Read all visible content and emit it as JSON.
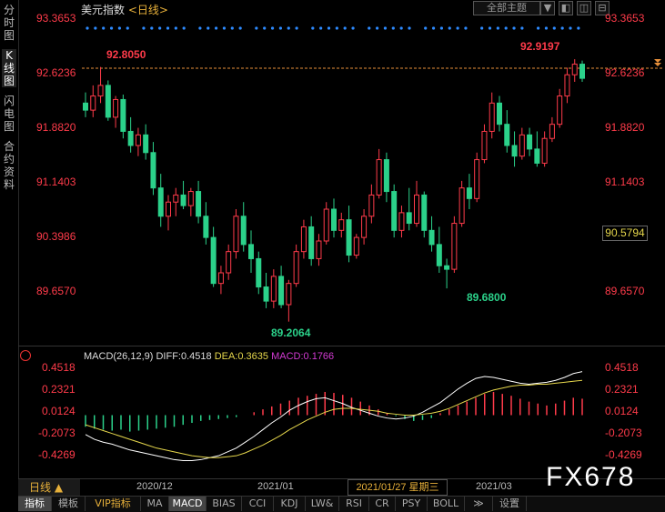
{
  "left_tabs": [
    "分时图",
    "K线图",
    "闪电图",
    "合约资料"
  ],
  "header": {
    "title": "美元指数",
    "period": "<日线>"
  },
  "top_controls": {
    "theme_select": "全部主题",
    "btn1": "▼",
    "btn2": "◧",
    "btn3": "◫",
    "btn4": "⊟"
  },
  "price_axis": {
    "left_labels": [
      "93.3653",
      "92.6236",
      "91.8820",
      "91.1403",
      "90.3986",
      "89.6570"
    ],
    "right_labels": [
      "93.3653",
      "92.6236",
      "91.8820",
      "91.1403",
      "90.3986",
      "89.6570"
    ],
    "current_price": "90.5794",
    "ylim": [
      89.0,
      93.5
    ]
  },
  "annotations": {
    "high_left": "92.8050",
    "high_right": "92.9197",
    "low_1": "89.2064",
    "low_2": "89.6800"
  },
  "macd": {
    "label": "MACD(26,12,9)",
    "diff": "DIFF:0.4518",
    "dea": "DEA:0.3635",
    "macd": "MACD:0.1766",
    "labels": [
      "0.4518",
      "0.2321",
      "0.0124",
      "-0.2073",
      "-0.4269"
    ]
  },
  "bottom": {
    "period_button": "日线 ▲",
    "dates": [
      "2020/12",
      "2021/01",
      "2021/03"
    ],
    "current_date": "2021/01/27 星期三"
  },
  "tabs": [
    "指标",
    "模板",
    "VIP指标",
    "MA",
    "MACD",
    "BIAS",
    "CCI",
    "KDJ",
    "LW&",
    "RSI",
    "CR",
    "PSY",
    "BOLL",
    "≫",
    "设置"
  ],
  "watermark": "FX678",
  "colors": {
    "up": "#ff3b4a",
    "down": "#2bd18a",
    "diff": "#ffffff",
    "dea": "#e6d74c",
    "macd_label": "#d33bd3",
    "period": "#e7b03a"
  },
  "chart_data": {
    "type": "candlestick",
    "candles": [
      {
        "o": 92.3,
        "h": 92.45,
        "l": 92.1,
        "c": 92.2
      },
      {
        "o": 92.2,
        "h": 92.55,
        "l": 92.1,
        "c": 92.4
      },
      {
        "o": 92.4,
        "h": 92.81,
        "l": 92.3,
        "c": 92.55
      },
      {
        "o": 92.55,
        "h": 92.62,
        "l": 92.05,
        "c": 92.1
      },
      {
        "o": 92.1,
        "h": 92.4,
        "l": 91.95,
        "c": 92.35
      },
      {
        "o": 92.35,
        "h": 92.42,
        "l": 91.8,
        "c": 91.9
      },
      {
        "o": 91.9,
        "h": 92.1,
        "l": 91.6,
        "c": 91.7
      },
      {
        "o": 91.7,
        "h": 91.95,
        "l": 91.55,
        "c": 91.85
      },
      {
        "o": 91.85,
        "h": 92.0,
        "l": 91.5,
        "c": 91.6
      },
      {
        "o": 91.6,
        "h": 91.75,
        "l": 91.0,
        "c": 91.1
      },
      {
        "o": 91.1,
        "h": 91.3,
        "l": 90.55,
        "c": 90.7
      },
      {
        "o": 90.7,
        "h": 91.0,
        "l": 90.5,
        "c": 90.9
      },
      {
        "o": 90.9,
        "h": 91.1,
        "l": 90.7,
        "c": 91.0
      },
      {
        "o": 91.0,
        "h": 91.2,
        "l": 90.8,
        "c": 90.85
      },
      {
        "o": 90.85,
        "h": 91.1,
        "l": 90.7,
        "c": 91.05
      },
      {
        "o": 91.05,
        "h": 91.2,
        "l": 90.6,
        "c": 90.7
      },
      {
        "o": 90.7,
        "h": 90.9,
        "l": 90.3,
        "c": 90.4
      },
      {
        "o": 90.4,
        "h": 90.55,
        "l": 89.7,
        "c": 89.75
      },
      {
        "o": 89.75,
        "h": 90.0,
        "l": 89.6,
        "c": 89.9
      },
      {
        "o": 89.9,
        "h": 90.3,
        "l": 89.8,
        "c": 90.2
      },
      {
        "o": 90.2,
        "h": 90.8,
        "l": 90.1,
        "c": 90.7
      },
      {
        "o": 90.7,
        "h": 90.9,
        "l": 90.2,
        "c": 90.3
      },
      {
        "o": 90.3,
        "h": 90.5,
        "l": 89.9,
        "c": 90.1
      },
      {
        "o": 90.1,
        "h": 90.2,
        "l": 89.6,
        "c": 89.7
      },
      {
        "o": 89.7,
        "h": 89.9,
        "l": 89.4,
        "c": 89.5
      },
      {
        "o": 89.5,
        "h": 89.95,
        "l": 89.4,
        "c": 89.85
      },
      {
        "o": 89.85,
        "h": 90.0,
        "l": 89.4,
        "c": 89.45
      },
      {
        "o": 89.45,
        "h": 89.8,
        "l": 89.21,
        "c": 89.75
      },
      {
        "o": 89.75,
        "h": 90.3,
        "l": 89.7,
        "c": 90.2
      },
      {
        "o": 90.2,
        "h": 90.65,
        "l": 90.1,
        "c": 90.55
      },
      {
        "o": 90.55,
        "h": 90.7,
        "l": 90.0,
        "c": 90.1
      },
      {
        "o": 90.1,
        "h": 90.45,
        "l": 90.0,
        "c": 90.35
      },
      {
        "o": 90.35,
        "h": 90.9,
        "l": 90.3,
        "c": 90.8
      },
      {
        "o": 90.8,
        "h": 90.95,
        "l": 90.4,
        "c": 90.5
      },
      {
        "o": 90.5,
        "h": 90.75,
        "l": 90.4,
        "c": 90.65
      },
      {
        "o": 90.65,
        "h": 90.85,
        "l": 90.05,
        "c": 90.15
      },
      {
        "o": 90.15,
        "h": 90.45,
        "l": 90.1,
        "c": 90.4
      },
      {
        "o": 90.4,
        "h": 90.8,
        "l": 90.3,
        "c": 90.7
      },
      {
        "o": 90.7,
        "h": 91.15,
        "l": 90.6,
        "c": 91.0
      },
      {
        "o": 91.0,
        "h": 91.65,
        "l": 90.95,
        "c": 91.5
      },
      {
        "o": 91.5,
        "h": 91.6,
        "l": 90.9,
        "c": 91.05
      },
      {
        "o": 91.05,
        "h": 91.15,
        "l": 90.4,
        "c": 90.5
      },
      {
        "o": 90.5,
        "h": 90.85,
        "l": 90.4,
        "c": 90.75
      },
      {
        "o": 90.75,
        "h": 91.1,
        "l": 90.5,
        "c": 90.6
      },
      {
        "o": 90.6,
        "h": 91.2,
        "l": 90.55,
        "c": 91.0
      },
      {
        "o": 91.0,
        "h": 91.05,
        "l": 90.4,
        "c": 90.5
      },
      {
        "o": 90.5,
        "h": 90.7,
        "l": 90.2,
        "c": 90.3
      },
      {
        "o": 90.3,
        "h": 90.55,
        "l": 89.9,
        "c": 90.0
      },
      {
        "o": 90.0,
        "h": 90.1,
        "l": 89.68,
        "c": 89.95
      },
      {
        "o": 89.95,
        "h": 90.7,
        "l": 89.9,
        "c": 90.6
      },
      {
        "o": 90.6,
        "h": 91.2,
        "l": 90.55,
        "c": 91.1
      },
      {
        "o": 91.1,
        "h": 91.3,
        "l": 90.8,
        "c": 90.95
      },
      {
        "o": 90.95,
        "h": 91.6,
        "l": 90.9,
        "c": 91.5
      },
      {
        "o": 91.5,
        "h": 92.0,
        "l": 91.45,
        "c": 91.9
      },
      {
        "o": 91.9,
        "h": 92.45,
        "l": 91.8,
        "c": 92.3
      },
      {
        "o": 92.3,
        "h": 92.4,
        "l": 91.9,
        "c": 92.0
      },
      {
        "o": 92.0,
        "h": 92.2,
        "l": 91.6,
        "c": 91.7
      },
      {
        "o": 91.7,
        "h": 91.9,
        "l": 91.4,
        "c": 91.55
      },
      {
        "o": 91.55,
        "h": 91.95,
        "l": 91.5,
        "c": 91.85
      },
      {
        "o": 91.85,
        "h": 91.95,
        "l": 91.55,
        "c": 91.65
      },
      {
        "o": 91.65,
        "h": 91.9,
        "l": 91.4,
        "c": 91.45
      },
      {
        "o": 91.45,
        "h": 91.9,
        "l": 91.4,
        "c": 91.8
      },
      {
        "o": 91.8,
        "h": 92.1,
        "l": 91.75,
        "c": 92.0
      },
      {
        "o": 92.0,
        "h": 92.5,
        "l": 91.95,
        "c": 92.4
      },
      {
        "o": 92.4,
        "h": 92.8,
        "l": 92.3,
        "c": 92.7
      },
      {
        "o": 92.7,
        "h": 92.92,
        "l": 92.6,
        "c": 92.85
      },
      {
        "o": 92.85,
        "h": 92.9,
        "l": 92.6,
        "c": 92.65
      }
    ],
    "macd_series": {
      "hist": [
        -0.12,
        -0.14,
        -0.15,
        -0.16,
        -0.15,
        -0.17,
        -0.16,
        -0.15,
        -0.14,
        -0.13,
        -0.12,
        -0.1,
        -0.08,
        -0.06,
        -0.05,
        -0.04,
        -0.03,
        -0.02,
        0.0,
        0.03,
        0.06,
        0.09,
        0.12,
        0.15,
        0.18,
        0.2,
        0.22,
        0.24,
        0.23,
        0.21,
        0.18,
        0.14,
        0.1,
        0.06,
        0.02,
        -0.01,
        -0.04,
        -0.06,
        -0.05,
        -0.03,
        0.02,
        0.06,
        0.1,
        0.14,
        0.18,
        0.22,
        0.24,
        0.22,
        0.2,
        0.17,
        0.14,
        0.12,
        0.1,
        0.12,
        0.15,
        0.18,
        0.17
      ],
      "diff": [
        -0.2,
        -0.25,
        -0.28,
        -0.3,
        -0.33,
        -0.36,
        -0.38,
        -0.4,
        -0.42,
        -0.44,
        -0.46,
        -0.47,
        -0.47,
        -0.46,
        -0.44,
        -0.42,
        -0.38,
        -0.34,
        -0.28,
        -0.22,
        -0.15,
        -0.08,
        -0.02,
        0.05,
        0.1,
        0.14,
        0.17,
        0.18,
        0.15,
        0.12,
        0.08,
        0.05,
        0.02,
        -0.01,
        -0.03,
        -0.04,
        -0.03,
        -0.01,
        0.03,
        0.08,
        0.13,
        0.2,
        0.27,
        0.33,
        0.38,
        0.4,
        0.39,
        0.37,
        0.35,
        0.33,
        0.32,
        0.33,
        0.34,
        0.36,
        0.39,
        0.43,
        0.45
      ],
      "dea": [
        -0.1,
        -0.13,
        -0.16,
        -0.19,
        -0.22,
        -0.25,
        -0.28,
        -0.31,
        -0.34,
        -0.36,
        -0.38,
        -0.4,
        -0.42,
        -0.43,
        -0.44,
        -0.44,
        -0.43,
        -0.42,
        -0.39,
        -0.35,
        -0.31,
        -0.26,
        -0.21,
        -0.15,
        -0.1,
        -0.05,
        -0.01,
        0.03,
        0.06,
        0.07,
        0.07,
        0.06,
        0.05,
        0.04,
        0.02,
        0.01,
        0.0,
        0.0,
        0.01,
        0.02,
        0.04,
        0.07,
        0.11,
        0.15,
        0.19,
        0.23,
        0.26,
        0.28,
        0.3,
        0.31,
        0.31,
        0.32,
        0.32,
        0.33,
        0.34,
        0.35,
        0.36
      ]
    }
  }
}
